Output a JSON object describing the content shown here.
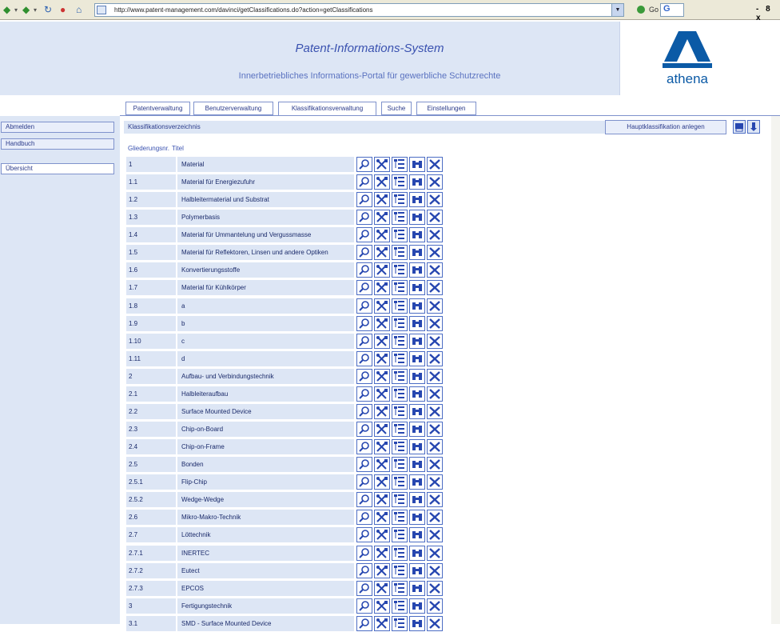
{
  "browser": {
    "url": "http://www.patent-management.com/davinci/getClassifications.do?action=getClassifications",
    "window_controls": "- 8 x"
  },
  "header": {
    "title": "Patent-Informations-System",
    "subtitle": "Innerbetriebliches Informations-Portal für gewerbliche Schutzrechte",
    "logo_text": "athena"
  },
  "tabs": [
    {
      "label": "Patentverwaltung"
    },
    {
      "label": "Benutzerverwaltung"
    },
    {
      "label": "Klassifikationsverwaltung",
      "active": true
    },
    {
      "label": "Suche"
    },
    {
      "label": "Einstellungen"
    }
  ],
  "sidebar": {
    "items": [
      {
        "label": "Abmelden"
      },
      {
        "label": "Handbuch"
      },
      {
        "label": "Übersicht"
      }
    ]
  },
  "main": {
    "section_title": "Klassifikationsverzeichnis",
    "add_button": "Hauptklassifikation anlegen",
    "col_number": "Gliederungsnr.",
    "col_title": "Titel",
    "rows": [
      {
        "num": "1",
        "title": "Material"
      },
      {
        "num": "1.1",
        "title": "Material für Energiezufuhr"
      },
      {
        "num": "1.2",
        "title": "Halbleitermaterial und Substrat"
      },
      {
        "num": "1.3",
        "title": "Polymerbasis"
      },
      {
        "num": "1.4",
        "title": "Material für Ummantelung und Vergussmasse"
      },
      {
        "num": "1.5",
        "title": "Material für Reflektoren, Linsen und andere Optiken"
      },
      {
        "num": "1.6",
        "title": "Konvertierungsstoffe"
      },
      {
        "num": "1.7",
        "title": "Material für Kühlkörper"
      },
      {
        "num": "1.8",
        "title": "a"
      },
      {
        "num": "1.9",
        "title": "b"
      },
      {
        "num": "1.10",
        "title": "c"
      },
      {
        "num": "1.11",
        "title": "d"
      },
      {
        "num": "2",
        "title": "Aufbau- und Verbindungstechnik"
      },
      {
        "num": "2.1",
        "title": "Halbleiteraufbau"
      },
      {
        "num": "2.2",
        "title": "Surface Mounted Device"
      },
      {
        "num": "2.3",
        "title": "Chip-on-Board"
      },
      {
        "num": "2.4",
        "title": "Chip-on-Frame"
      },
      {
        "num": "2.5",
        "title": "Bonden"
      },
      {
        "num": "2.5.1",
        "title": "Flip-Chip"
      },
      {
        "num": "2.5.2",
        "title": "Wedge-Wedge"
      },
      {
        "num": "2.6",
        "title": "Mikro-Makro-Technik"
      },
      {
        "num": "2.7",
        "title": "Löttechnik"
      },
      {
        "num": "2.7.1",
        "title": "INERTEC"
      },
      {
        "num": "2.7.2",
        "title": "Eutect"
      },
      {
        "num": "2.7.3",
        "title": "EPCOS"
      },
      {
        "num": "3",
        "title": "Fertigungstechnik"
      },
      {
        "num": "3.1",
        "title": "SMD - Surface Mounted Device"
      }
    ]
  },
  "colors": {
    "panel": "#dde6f5",
    "accent": "#2747b0",
    "text": "#1a2a6a"
  }
}
